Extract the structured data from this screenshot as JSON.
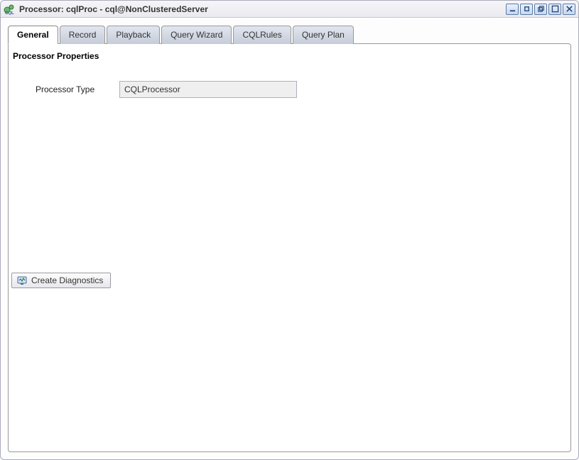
{
  "window": {
    "title": "Processor: cqlProc - cql@NonClusteredServer"
  },
  "tabs": [
    {
      "label": "General"
    },
    {
      "label": "Record"
    },
    {
      "label": "Playback"
    },
    {
      "label": "Query Wizard"
    },
    {
      "label": "CQLRules"
    },
    {
      "label": "Query Plan"
    }
  ],
  "panel": {
    "section_title": "Processor Properties",
    "processor_type_label": "Processor Type",
    "processor_type_value": "CQLProcessor"
  },
  "actions": {
    "create_diagnostics_label": "Create Diagnostics"
  }
}
